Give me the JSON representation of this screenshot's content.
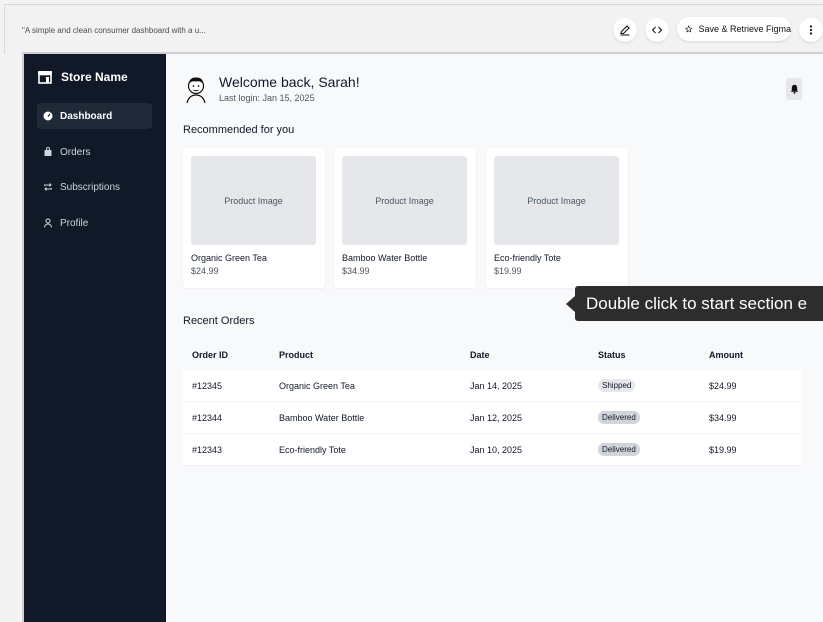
{
  "toolbar": {
    "prompt_text": "\"A simple and clean consumer dashboard with a u...",
    "edit_icon": "pencil-icon",
    "code_icon": "code-icon",
    "figma_label": "Save & Retrieve Figma",
    "figma_icon": "star-icon",
    "more_icon": "vertical-dots-icon"
  },
  "sidebar": {
    "brand": "Store Name",
    "brand_icon": "store-icon",
    "items": [
      {
        "label": "Dashboard",
        "icon": "gauge-icon",
        "active": true
      },
      {
        "label": "Orders",
        "icon": "bag-icon",
        "active": false
      },
      {
        "label": "Subscriptions",
        "icon": "repeat-icon",
        "active": false
      },
      {
        "label": "Profile",
        "icon": "user-icon",
        "active": false
      }
    ]
  },
  "header": {
    "welcome": "Welcome back, Sarah!",
    "last_login": "Last login: Jan 15, 2025",
    "bell_icon": "bell-icon"
  },
  "recommended": {
    "title": "Recommended for you",
    "products": [
      {
        "image_label": "Product Image",
        "name": "Organic Green Tea",
        "price": "$24.99"
      },
      {
        "image_label": "Product Image",
        "name": "Bamboo Water Bottle",
        "price": "$34.99"
      },
      {
        "image_label": "Product Image",
        "name": "Eco-friendly Tote",
        "price": "$19.99"
      }
    ]
  },
  "orders": {
    "title": "Recent Orders",
    "columns": [
      "Order ID",
      "Product",
      "Date",
      "Status",
      "Amount"
    ],
    "rows": [
      {
        "id": "#12345",
        "product": "Organic Green Tea",
        "date": "Jan 14, 2025",
        "status": "Shipped",
        "amount": "$24.99"
      },
      {
        "id": "#12344",
        "product": "Bamboo Water Bottle",
        "date": "Jan 12, 2025",
        "status": "Delivered",
        "amount": "$34.99"
      },
      {
        "id": "#12343",
        "product": "Eco-friendly Tote",
        "date": "Jan 10, 2025",
        "status": "Delivered",
        "amount": "$19.99"
      }
    ]
  },
  "tooltip": {
    "text": "Double click to start section e"
  },
  "colors": {
    "sidebar_bg": "#111827",
    "active_bg": "#1f2937",
    "page_bg": "#f8f9fb",
    "tooltip_bg": "#2d2d2d"
  }
}
